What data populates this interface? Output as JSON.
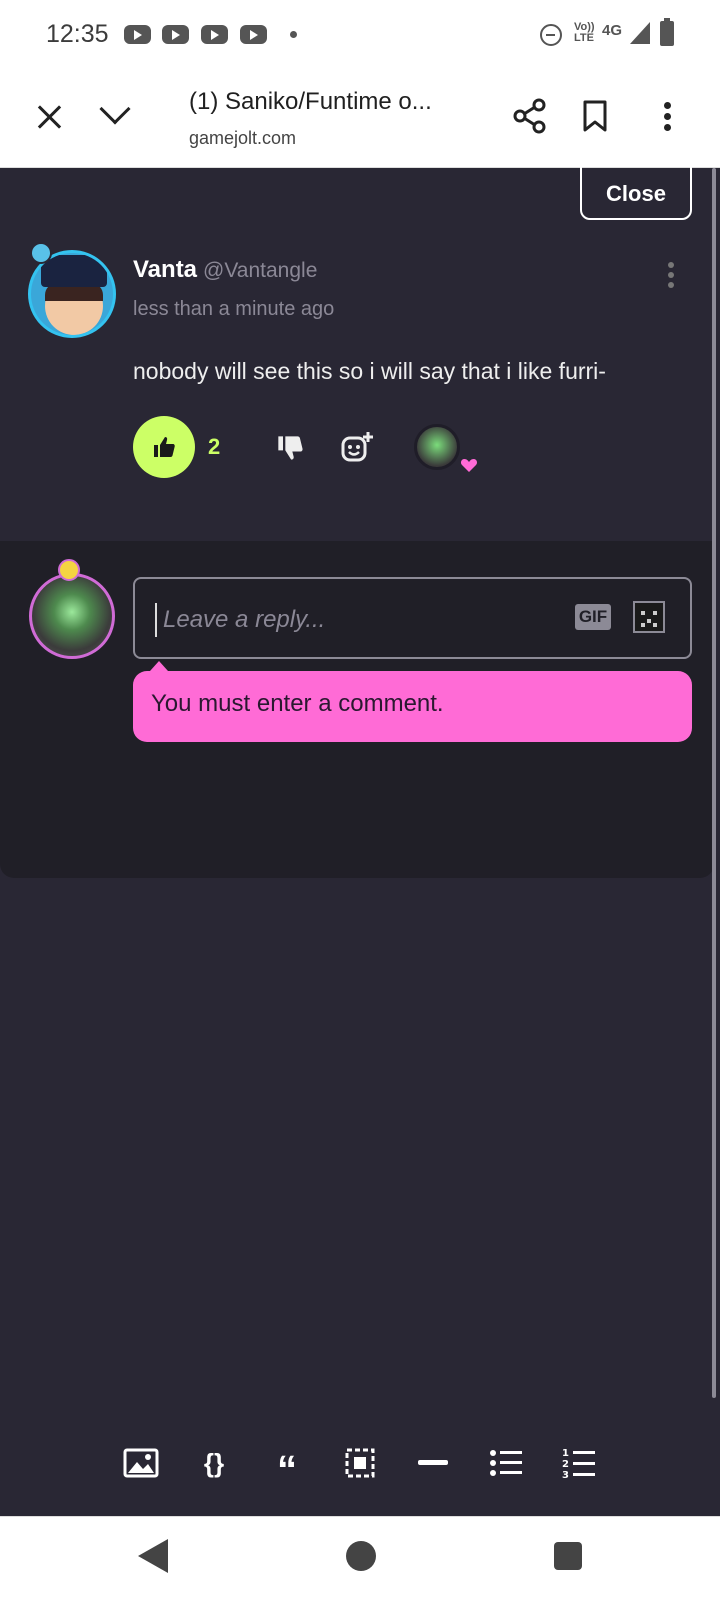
{
  "status_bar": {
    "time": "12:35",
    "volte_label": "Vo)) LTE",
    "network": "4G",
    "icons": [
      "youtube-icon",
      "youtube-icon",
      "youtube-icon",
      "youtube-icon",
      "dot-icon",
      "do-not-disturb-icon",
      "volte-icon",
      "signal-icon",
      "battery-icon"
    ]
  },
  "browser": {
    "title": "(1) Saniko/Funtime o...",
    "url": "gamejolt.com",
    "icons": [
      "close-icon",
      "chevron-down-icon",
      "share-icon",
      "bookmark-icon",
      "more-vert-icon"
    ]
  },
  "comment": {
    "close_label": "Close",
    "author": "Vanta",
    "handle": "@Vantangle",
    "time_ago": "less than a minute ago",
    "text": "nobody will see this so i will say that i like furri-",
    "like_count": "2"
  },
  "reply": {
    "placeholder": "Leave a reply...",
    "gif_label": "GIF",
    "error": "You must enter a comment."
  },
  "toolbar": {
    "code_label": "{}",
    "quote_label": "“",
    "tools": [
      "image-icon",
      "code-icon",
      "quote-icon",
      "spoiler-icon",
      "horizontal-rule-icon",
      "bulleted-list-icon",
      "numbered-list-icon"
    ]
  },
  "nav": {
    "icons": [
      "back-icon",
      "home-icon",
      "recent-apps-icon"
    ]
  },
  "colors": {
    "background": "#292734",
    "panel": "#201f27",
    "like_green": "#ccff66",
    "error_pink": "#ff6bd6",
    "muted": "#8b8896"
  }
}
